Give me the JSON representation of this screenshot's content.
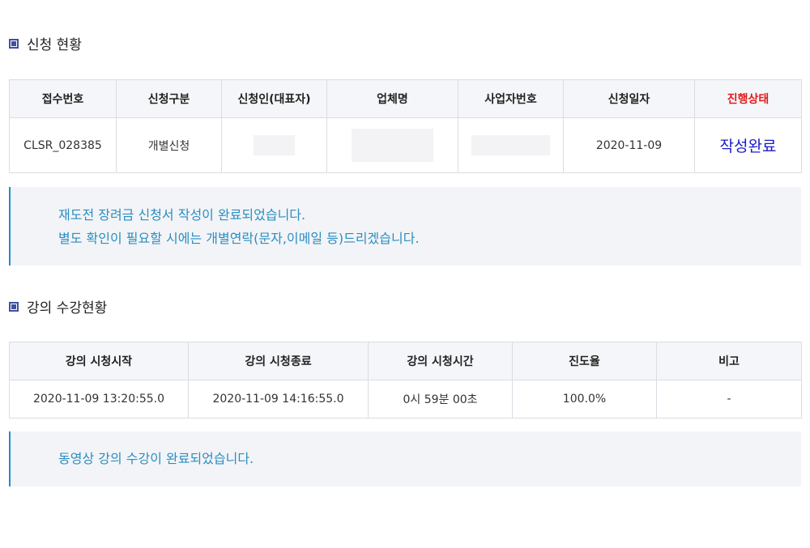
{
  "application_section": {
    "title": "신청 현황",
    "table": {
      "headers": [
        "접수번호",
        "신청구분",
        "신청인(대표자)",
        "업체명",
        "사업자번호",
        "신청일자",
        "진행상태"
      ],
      "row": {
        "receipt_no": "CLSR_028385",
        "category": "개별신청",
        "applicant": "",
        "company": "",
        "business_no": "",
        "date": "2020-11-09",
        "status": "작성완료"
      }
    },
    "notice": {
      "line1": "재도전 장려금 신청서 작성이 완료되었습니다.",
      "line2": "별도 확인이 필요할 시에는 개별연락(문자,이메일 등)드리겠습니다."
    }
  },
  "lecture_section": {
    "title": "강의 수강현황",
    "table": {
      "headers": [
        "강의 시청시작",
        "강의 시청종료",
        "강의 시청시간",
        "진도율",
        "비고"
      ],
      "row": {
        "start": "2020-11-09 13:20:55.0",
        "end": "2020-11-09 14:16:55.0",
        "duration": "0시 59분 00초",
        "progress": "100.0%",
        "note": "-"
      }
    },
    "notice": {
      "line1": "동영상 강의 수강이 완료되었습니다."
    }
  },
  "colors": {
    "accent": "#3f4fa3",
    "status_header": "#e01b1b",
    "status_value": "#1a1acc",
    "notice_text": "#2a8ec2",
    "notice_border": "#1f8fc2"
  }
}
